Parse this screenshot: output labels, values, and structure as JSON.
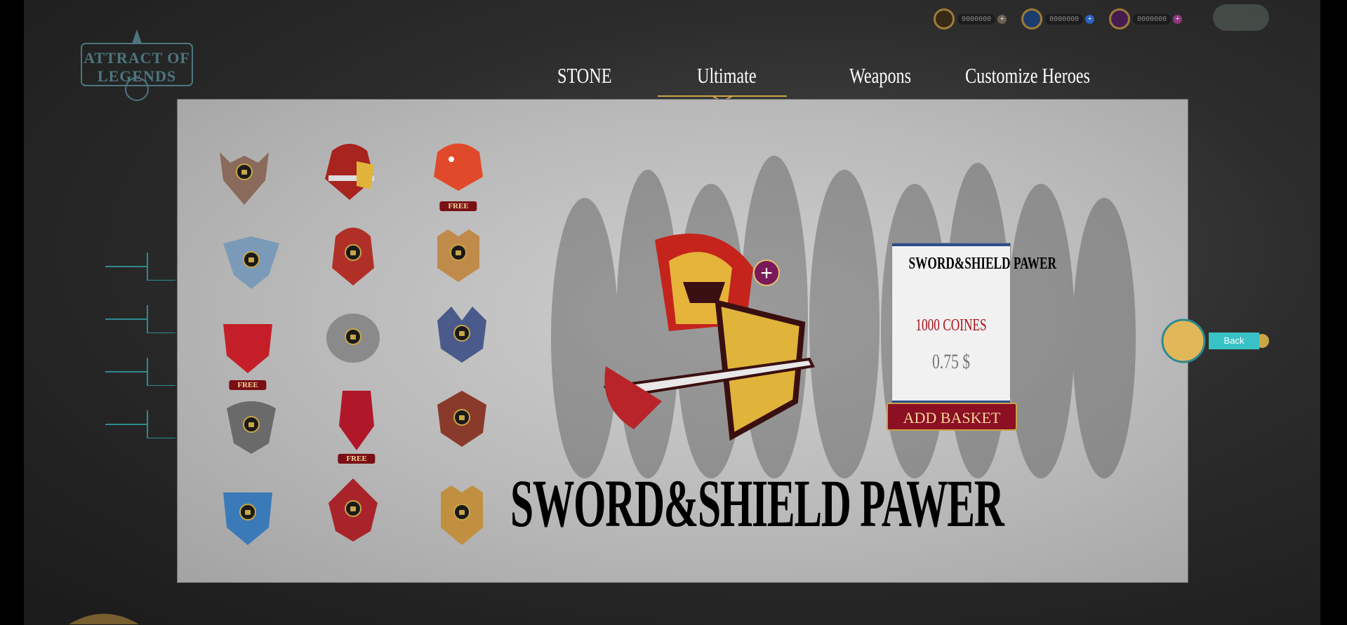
{
  "app": {
    "logo_text": "ATTRACT OF LEGENDS"
  },
  "currencies": [
    {
      "icon": "gold-coin-icon",
      "value": "0000000",
      "color": "#c9a646"
    },
    {
      "icon": "blue-gem-icon",
      "value": "0000000",
      "color": "#2c6bd6"
    },
    {
      "icon": "purple-gem-icon",
      "value": "0000000",
      "color": "#7a2c9a"
    }
  ],
  "tabs": [
    {
      "label": "STONE",
      "active": false
    },
    {
      "label": "Ultimate",
      "active": true
    },
    {
      "label": "Weapons",
      "active": false
    },
    {
      "label": "Customize Heroes",
      "active": false
    }
  ],
  "items": [
    {
      "name": "horned-demon-emblem",
      "locked": true,
      "free": false
    },
    {
      "name": "sword-shield-knight-emblem",
      "locked": false,
      "free": false,
      "selected": true
    },
    {
      "name": "fire-dragon-emblem",
      "locked": false,
      "free": true
    },
    {
      "name": "winged-crest-emblem",
      "locked": true,
      "free": false
    },
    {
      "name": "red-knight-emblem",
      "locked": true,
      "free": false
    },
    {
      "name": "tiger-emblem",
      "locked": true,
      "free": false
    },
    {
      "name": "red-bull-emblem",
      "locked": false,
      "free": true
    },
    {
      "name": "scorpion-emblem",
      "locked": true,
      "free": false
    },
    {
      "name": "wolf-emblem",
      "locked": true,
      "free": false
    },
    {
      "name": "eagle-emblem",
      "locked": true,
      "free": false
    },
    {
      "name": "red-mask-emblem",
      "locked": false,
      "free": true
    },
    {
      "name": "samurai-emblem",
      "locked": true,
      "free": false
    },
    {
      "name": "blue-crest-emblem",
      "locked": true,
      "free": false
    },
    {
      "name": "crimson-crest-emblem",
      "locked": true,
      "free": false
    },
    {
      "name": "lion-crown-emblem",
      "locked": true,
      "free": false
    }
  ],
  "free_label": "FREE",
  "selected": {
    "title": "SWORD&SHIELD PAWER",
    "card_name": "SWORD&SHIELD PAWER",
    "coins": "1000 COINES",
    "price": "0.75 $",
    "add_basket_label": "ADD BASKET"
  },
  "back_label": "Back",
  "colors": {
    "accent_red": "#8c0f23",
    "accent_gold": "#c9a646",
    "cart_pink": "#c01f6e",
    "back_teal": "#38c2c6"
  }
}
